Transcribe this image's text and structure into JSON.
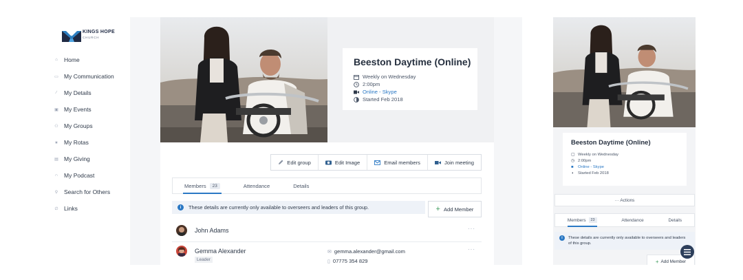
{
  "brand": {
    "name": "KINGS HOPE",
    "sub": "CHURCH"
  },
  "nav": [
    {
      "label": "Home",
      "icon": "home-icon"
    },
    {
      "label": "My Communication",
      "icon": "chat-icon"
    },
    {
      "label": "My Details",
      "icon": "pencil-icon"
    },
    {
      "label": "My Events",
      "icon": "calendar-icon"
    },
    {
      "label": "My Groups",
      "icon": "people-icon"
    },
    {
      "label": "My Rotas",
      "icon": "star-icon"
    },
    {
      "label": "My Giving",
      "icon": "card-icon"
    },
    {
      "label": "My Podcast",
      "icon": "headphones-icon"
    },
    {
      "label": "Search for Others",
      "icon": "search-people-icon"
    },
    {
      "label": "Links",
      "icon": "link-icon"
    }
  ],
  "group": {
    "title": "Beeston Daytime (Online)",
    "schedule": "Weekly on Wednesday",
    "time": "2:00pm",
    "location": "Online - Skype",
    "started": "Started Feb 2018"
  },
  "toolbar": {
    "edit_group": "Edit group",
    "edit_image": "Edit Image",
    "email_members": "Email members",
    "join_meeting": "Join meeting"
  },
  "tabs": {
    "members": "Members",
    "members_count": "23",
    "attendance": "Attendance",
    "details": "Details"
  },
  "notice": "These details are currently only available to overseers and leaders of this group.",
  "add_member": "Add Member",
  "members": [
    {
      "name": "John Adams",
      "more": "···"
    },
    {
      "name": "Gemma Alexander",
      "role": "Leader",
      "email": "gemma.alexander@gmail.com",
      "phone": "07775 354 829",
      "more": "···"
    }
  ],
  "mobile": {
    "title": "Beeston Daytime (Online)",
    "schedule": "Weekly on Wednesday",
    "time": "2:00pm",
    "location": "Online - Skype",
    "started": "Started Feb 2018",
    "actions": "··· Actions",
    "tabs": {
      "members": "Members",
      "members_count": "23",
      "attendance": "Attendance",
      "details": "Details"
    },
    "notice": "These details are currently only available to overseers and leaders of this group.",
    "add_member": "Add Member"
  },
  "colors": {
    "accent": "#2a78c4",
    "add_plus": "#3a9a5a",
    "fab": "#2c3e5a"
  }
}
